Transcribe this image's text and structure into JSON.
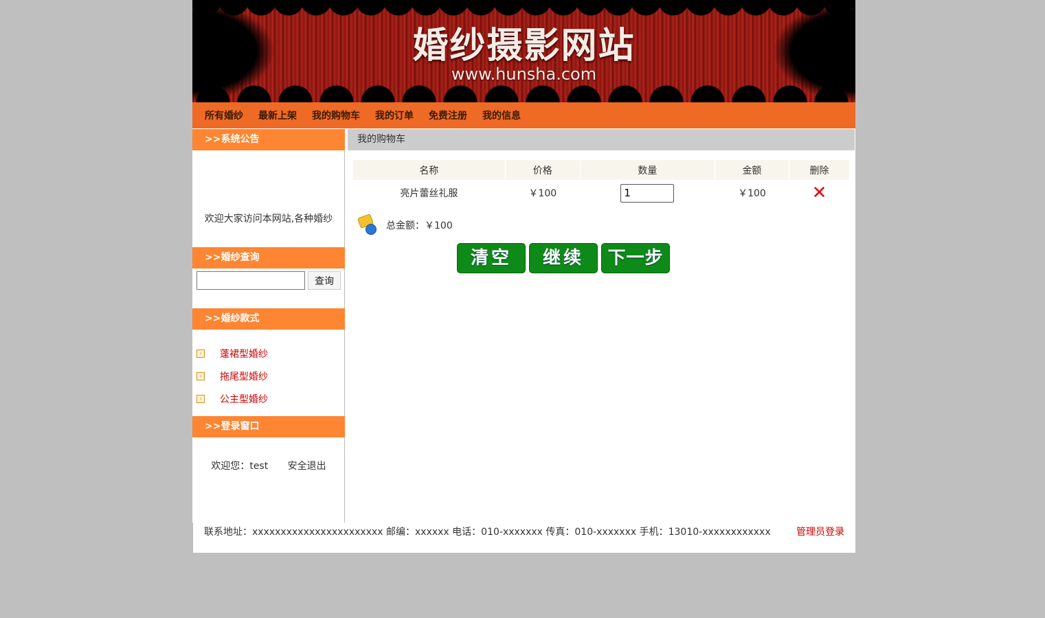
{
  "banner": {
    "title": "婚纱摄影网站",
    "url": "www.hunsha.com"
  },
  "nav": [
    {
      "label": "所有婚纱"
    },
    {
      "label": "最新上架"
    },
    {
      "label": "我的购物车"
    },
    {
      "label": "我的订单"
    },
    {
      "label": "免费注册"
    },
    {
      "label": "我的信息"
    }
  ],
  "sidebar": {
    "notice_title": ">>系统公告",
    "notice_text": "欢迎大家访问本网站,各种婚纱",
    "search_title": ">>婚纱查询",
    "search_value": "",
    "search_button": "查询",
    "category_title": ">>婚纱款式",
    "categories": [
      {
        "label": "蓬裙型婚纱"
      },
      {
        "label": "拖尾型婚纱"
      },
      {
        "label": "公主型婚纱"
      }
    ],
    "login_title": ">>登录窗口",
    "welcome": "欢迎您：test",
    "logout": "安全退出"
  },
  "main": {
    "title": "我的购物车",
    "columns": [
      "名称",
      "价格",
      "数量",
      "金额",
      "删除"
    ],
    "rows": [
      {
        "name": "亮片蕾丝礼服",
        "price": "￥100",
        "qty": "1",
        "amount": "￥100"
      }
    ],
    "total_label": "总金额：￥100",
    "buttons": {
      "clear": "清空",
      "continue": "继续",
      "next": "下一步"
    }
  },
  "footer": {
    "info": "联系地址：xxxxxxxxxxxxxxxxxxxxxxx    邮编：xxxxxx 电话：010-xxxxxxx    传真：010-xxxxxxx    手机：13010-xxxxxxxxxxxx",
    "admin_login": "管理员登录"
  },
  "colors": {
    "nav_bg": "#ee6a25",
    "section_head_bg": "#fe8532",
    "button_green": "#0d8a17",
    "link_red": "#cc0000"
  }
}
